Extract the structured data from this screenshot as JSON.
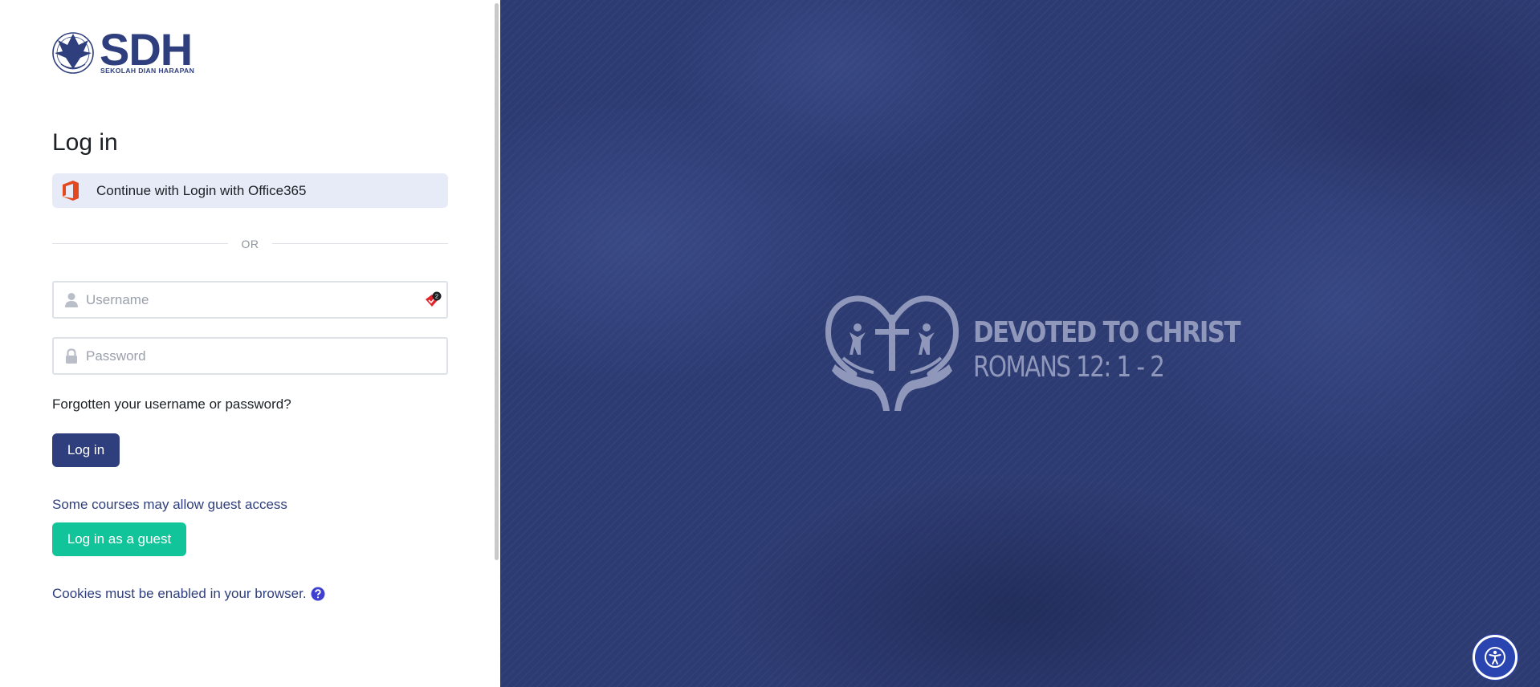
{
  "brand": {
    "logo_text": "SDH",
    "logo_subtitle": "SEKOLAH DIAN HARAPAN",
    "primary_color": "#2f3f7d",
    "accent_color": "#11c49a"
  },
  "login": {
    "title": "Log in",
    "oauth_button_label": "Continue with Login with Office365",
    "oauth_icon": "office365-icon",
    "divider_text": "OR",
    "username_placeholder": "Username",
    "username_value": "",
    "password_placeholder": "Password",
    "password_value": "",
    "password_manager_badge": "2",
    "forgot_link": "Forgotten your username or password?",
    "submit_label": "Log in"
  },
  "guest": {
    "info_text": "Some courses may allow guest access",
    "button_label": "Log in as a guest"
  },
  "cookies": {
    "notice_text": "Cookies must be enabled in your browser.",
    "help_icon": "question-circle-icon"
  },
  "hero": {
    "motto_line1": "DEVOTED TO CHRIST",
    "motto_line2": "ROMANS 12: 1 - 2"
  },
  "accessibility": {
    "button_icon": "accessibility-person-icon"
  }
}
